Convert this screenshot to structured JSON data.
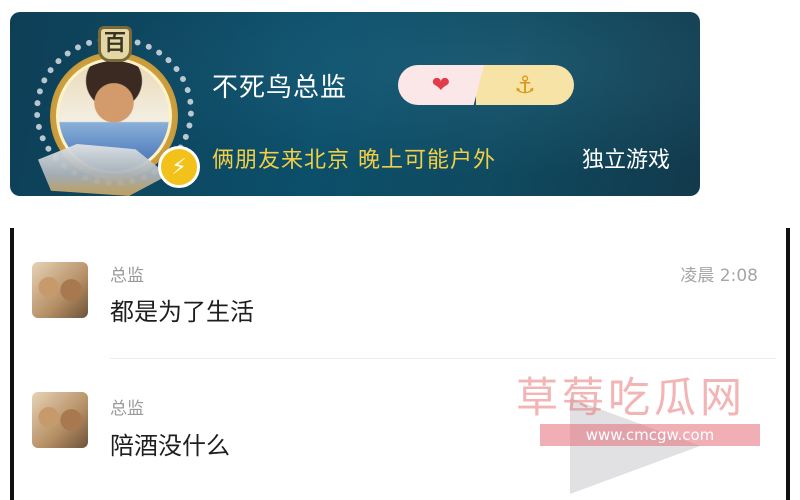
{
  "profile": {
    "rank_badge": "百",
    "username": "不死鸟总监",
    "status": "俩朋友来北京 晚上可能户外",
    "category": "独立游戏",
    "heart_glyph": "❤",
    "anchor_glyph": "⚓",
    "bolt_glyph": "⚡",
    "colors": {
      "card_bg": "#0c4f6a",
      "status_text": "#f2cf45",
      "heart": "#e23b4a",
      "anchor": "#d89a1a",
      "bolt_badge": "#f2c21a"
    }
  },
  "messages": [
    {
      "sender": "总监",
      "text": "都是为了生活",
      "time": "凌晨 2:08"
    },
    {
      "sender": "总监",
      "text": "陪酒没什么",
      "time": ""
    }
  ],
  "watermark": {
    "title": "草莓吃瓜网",
    "url": "www.cmcgw.com"
  }
}
